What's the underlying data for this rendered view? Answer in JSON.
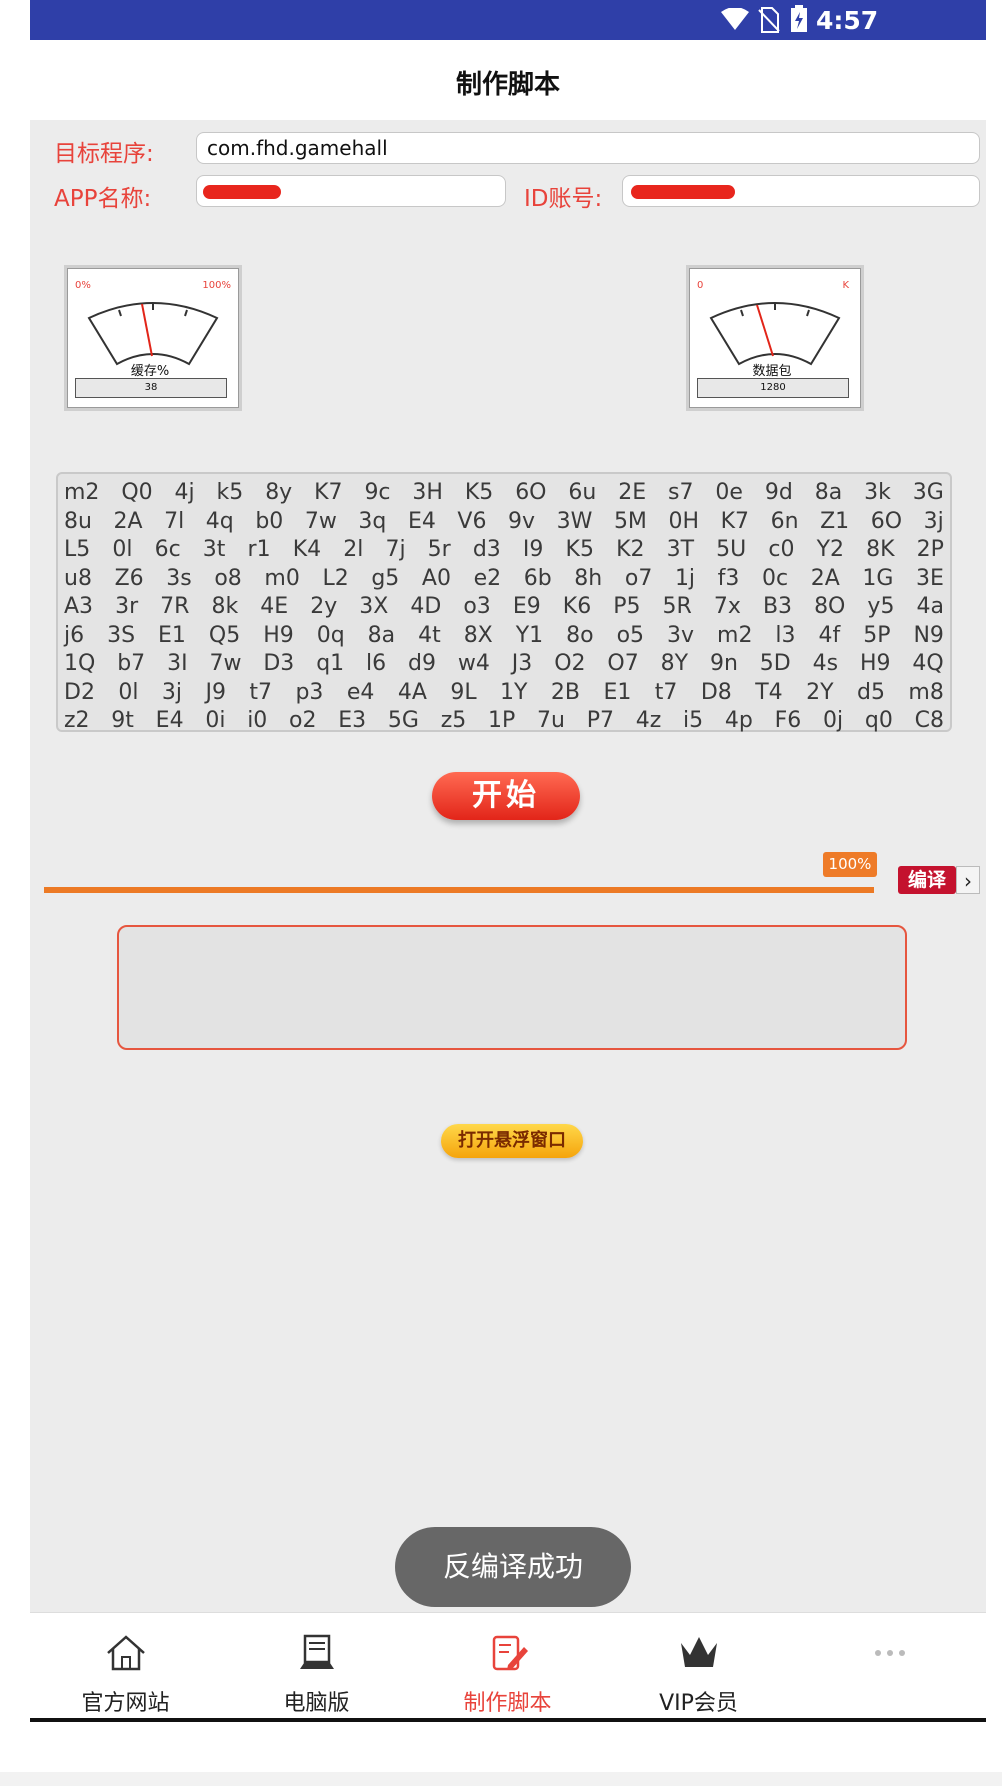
{
  "status_bar": {
    "time": "4:57"
  },
  "header": {
    "title": "制作脚本"
  },
  "form": {
    "target_label": "目标程序:",
    "target_value": "com.fhd.gamehall",
    "app_name_label": "APP名称:",
    "id_label": "ID账号:"
  },
  "gauges": {
    "cache": {
      "min_label": "0%",
      "max_label": "100%",
      "title": "缓存%",
      "value_text": "38"
    },
    "packet": {
      "min_label": "0",
      "max_label": "K",
      "title": "数据包",
      "value_text": "1280"
    }
  },
  "code_rows": [
    [
      "m2",
      "Q0",
      "4j",
      "k5",
      "8y",
      "K7",
      "9c",
      "3H",
      "K5",
      "6O",
      "6u",
      "2E",
      "s7",
      "0e",
      "9d",
      "8a",
      "3k",
      "3G"
    ],
    [
      "8u",
      "2A",
      "7l",
      "4q",
      "b0",
      "7w",
      "3q",
      "E4",
      "V6",
      "9v",
      "3W",
      "5M",
      "0H",
      "K7",
      "6n",
      "Z1",
      "6O",
      "3j"
    ],
    [
      "L5",
      "0l",
      "6c",
      "3t",
      "r1",
      "K4",
      "2l",
      "7j",
      "5r",
      "d3",
      "I9",
      "K5",
      "K2",
      "3T",
      "5U",
      "c0",
      "Y2",
      "8K",
      "2P"
    ],
    [
      "u8",
      "Z6",
      "3s",
      "o8",
      "m0",
      "L2",
      "g5",
      "A0",
      "e2",
      "6b",
      "8h",
      "o7",
      "1j",
      "f3",
      "0c",
      "2A",
      "1G",
      "3E"
    ],
    [
      "A3",
      "3r",
      "7R",
      "8k",
      "4E",
      "2y",
      "3X",
      "4D",
      "o3",
      "E9",
      "K6",
      "P5",
      "5R",
      "7x",
      "B3",
      "8O",
      "y5",
      "4a"
    ],
    [
      "j6",
      "3S",
      "E1",
      "Q5",
      "H9",
      "0q",
      "8a",
      "4t",
      "8X",
      "Y1",
      "8o",
      "o5",
      "3v",
      "m2",
      "l3",
      "4f",
      "5P",
      "N9"
    ],
    [
      "1Q",
      "b7",
      "3I",
      "7w",
      "D3",
      "q1",
      "l6",
      "d9",
      "w4",
      "J3",
      "O2",
      "O7",
      "8Y",
      "9n",
      "5D",
      "4s",
      "H9",
      "4Q"
    ],
    [
      "D2",
      "0l",
      "3j",
      "J9",
      "t7",
      "p3",
      "e4",
      "4A",
      "9L",
      "1Y",
      "2B",
      "E1",
      "t7",
      "D8",
      "T4",
      "2Y",
      "d5",
      "m8"
    ],
    [
      "z2",
      "9t",
      "E4",
      "0i",
      "i0",
      "o2",
      "E3",
      "5G",
      "z5",
      "1P",
      "7u",
      "P7",
      "4z",
      "i5",
      "4p",
      "F6",
      "0j",
      "q0",
      "C8"
    ]
  ],
  "start_button": "开始",
  "progress": {
    "percent": 100,
    "label": "100%"
  },
  "compile_button": "编译",
  "compile_arrow": "›",
  "float_button": "打开悬浮窗口",
  "toast": "反编译成功",
  "nav": [
    {
      "label": "官方网站",
      "icon": "home-icon"
    },
    {
      "label": "电脑版",
      "icon": "computer-icon"
    },
    {
      "label": "制作脚本",
      "icon": "edit-script-icon"
    },
    {
      "label": "VIP会员",
      "icon": "crown-icon"
    },
    {
      "label": "",
      "icon": "more-icon"
    }
  ],
  "colors": {
    "accent": "#e8433b",
    "status_bar": "#2f3fa8",
    "progress": "#ec7a25"
  }
}
